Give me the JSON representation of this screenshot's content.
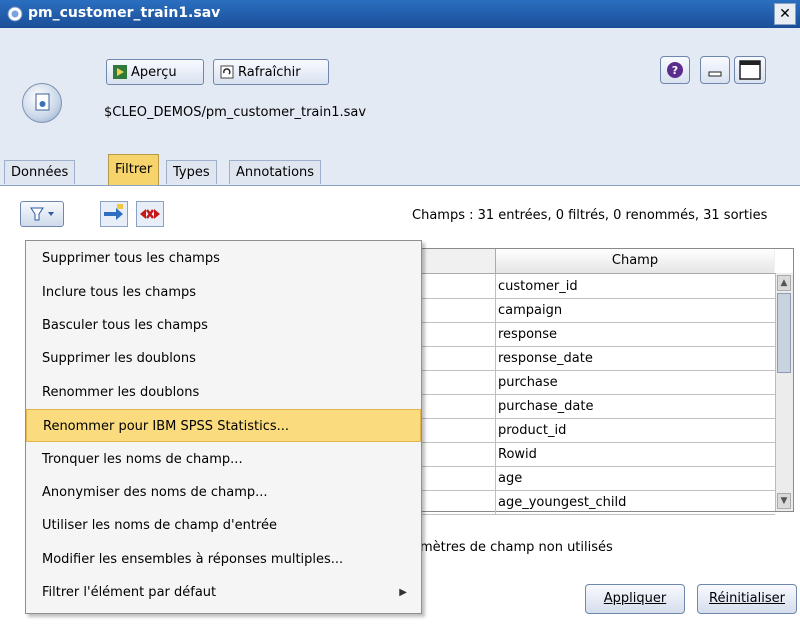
{
  "window": {
    "title": "pm_customer_train1.sav",
    "close_glyph": "✕"
  },
  "toolbar": {
    "preview_label": "Aperçu",
    "refresh_label": "Rafraîchir"
  },
  "file_path": "$CLEO_DEMOS/pm_customer_train1.sav",
  "tabs": [
    {
      "label": "Données",
      "active": false
    },
    {
      "label": "Filtrer",
      "active": true
    },
    {
      "label": "Types",
      "active": false
    },
    {
      "label": "Annotations",
      "active": false
    }
  ],
  "field_summary": "Champs : 31 entrées, 0 filtrés, 0 renommés, 31 sorties",
  "table": {
    "column_header": "Champ",
    "rows": [
      "customer_id",
      "campaign",
      "response",
      "response_date",
      "purchase",
      "purchase_date",
      "product_id",
      "Rowid",
      "age",
      "age_youngest_child"
    ]
  },
  "unused_text": "mètres de champ non utilisés",
  "buttons": {
    "apply": "Appliquer",
    "reset": "Réinitialiser"
  },
  "menu": {
    "items": [
      {
        "label": "Supprimer tous les champs",
        "highlighted": false,
        "submenu": false
      },
      {
        "label": "Inclure tous les champs",
        "highlighted": false,
        "submenu": false
      },
      {
        "label": "Basculer tous les champs",
        "highlighted": false,
        "submenu": false
      },
      {
        "label": "Supprimer les doublons",
        "highlighted": false,
        "submenu": false
      },
      {
        "label": "Renommer les doublons",
        "highlighted": false,
        "submenu": false
      },
      {
        "label": "Renommer pour IBM SPSS Statistics...",
        "highlighted": true,
        "submenu": false
      },
      {
        "label": "Tronquer les noms de champ...",
        "highlighted": false,
        "submenu": false
      },
      {
        "label": "Anonymiser des noms de champ...",
        "highlighted": false,
        "submenu": false
      },
      {
        "label": "Utiliser les noms de champ d'entrée",
        "highlighted": false,
        "submenu": false
      },
      {
        "label": "Modifier les ensembles à réponses multiples...",
        "highlighted": false,
        "submenu": false
      },
      {
        "label": "Filtrer l'élément par défaut",
        "highlighted": false,
        "submenu": true
      }
    ],
    "submenu_arrow": "▶"
  },
  "colors": {
    "title_bar": "#2b6fc0",
    "active_tab": "#f6d36b",
    "menu_highlight": "#fadc7f",
    "panel_bg": "#e4eaf4"
  },
  "icons": [
    "source-node-icon",
    "preview-icon",
    "refresh-icon",
    "help-icon",
    "minimize-icon",
    "maximize-icon",
    "filter-icon",
    "remove-field-icon"
  ]
}
